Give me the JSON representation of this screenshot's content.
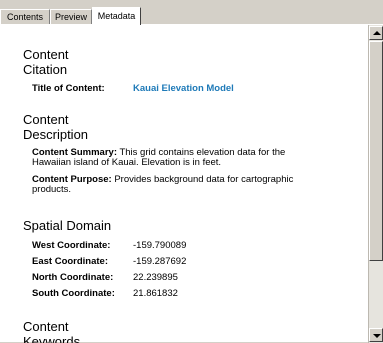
{
  "tabs": [
    {
      "label": "Contents"
    },
    {
      "label": "Preview"
    },
    {
      "label": "Metadata"
    }
  ],
  "citation": {
    "heading_line1": "Content",
    "heading_line2": "Citation",
    "title_label": "Title of Content:",
    "title_value": "Kauai Elevation Model"
  },
  "description": {
    "heading_line1": "Content",
    "heading_line2": "Description",
    "summary_label": "Content Summary:",
    "summary_text_1": " This grid contains elevation data for the",
    "summary_text_2": "Hawaiian island of Kauai. Elevation is in feet.",
    "purpose_label": "Content Purpose:",
    "purpose_text_1": " Provides background data for cartographic",
    "purpose_text_2": "products."
  },
  "spatial": {
    "heading": "Spatial Domain",
    "rows": [
      {
        "label": "West Coordinate:",
        "value": "-159.790089"
      },
      {
        "label": "East Coordinate:",
        "value": "-159.287692"
      },
      {
        "label": "North Coordinate:",
        "value": "22.239895"
      },
      {
        "label": "South Coordinate:",
        "value": "21.861832"
      }
    ]
  },
  "keywords": {
    "heading_line1": "Content",
    "heading_line2": "Keywords"
  }
}
